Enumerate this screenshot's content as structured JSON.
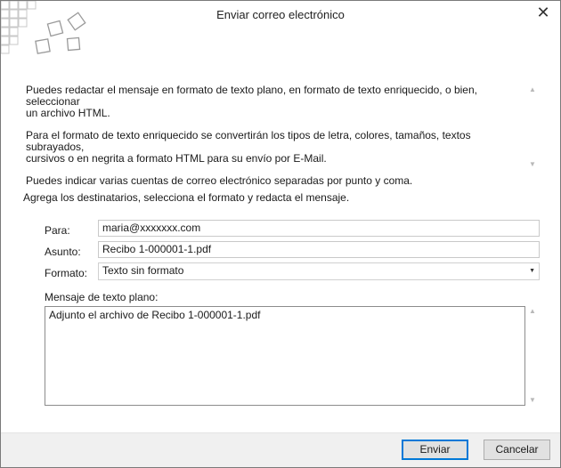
{
  "window": {
    "title": "Enviar correo electrónico",
    "close_glyph": "✕"
  },
  "info": {
    "paragraph1": "Puedes redactar el mensaje en formato de texto plano, en formato de texto enriquecido, o bien, seleccionar\nun archivo HTML.",
    "paragraph2": "Para el formato de texto enriquecido se convertirán los tipos de letra, colores, tamaños, textos subrayados,\ncursivos o en negrita a formato HTML para su envío por E-Mail.",
    "paragraph3": "Puedes indicar varias cuentas de correo electrónico separadas por punto y coma."
  },
  "instruction": "Agrega los destinatarios, selecciona el formato y redacta el mensaje.",
  "form": {
    "to_label": "Para:",
    "to_value": "maria@xxxxxxx.com",
    "subject_label": "Asunto:",
    "subject_value": "Recibo 1-000001-1.pdf",
    "format_label": "Formato:",
    "format_value": "Texto sin formato",
    "message_label": "Mensaje de texto plano:",
    "message_value": "Adjunto el archivo de Recibo 1-000001-1.pdf"
  },
  "buttons": {
    "send": "Enviar",
    "cancel": "Cancelar"
  },
  "icons": {
    "logo": "squares-logo-icon",
    "close": "close-icon",
    "dropdown": "chevron-down-icon",
    "scroll_up": "scroll-up-icon",
    "scroll_down": "scroll-down-icon"
  }
}
